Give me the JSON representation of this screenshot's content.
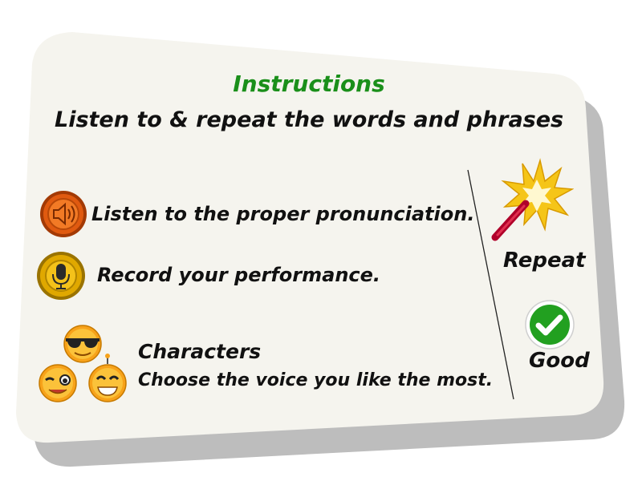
{
  "instructions": {
    "title": "Instructions",
    "subtitle": "Listen to & repeat the words and phrases",
    "listen_text": "Listen to the proper pronunciation.",
    "record_text": "Record your performance.",
    "characters_title": "Characters",
    "characters_text": "Choose the voice you like the most.",
    "repeat_label": "Repeat",
    "good_label": "Good"
  },
  "icons": {
    "listen": "speaker-icon",
    "record": "microphone-icon",
    "characters": [
      "sunglasses-face-icon",
      "winking-face-icon",
      "grinning-face-icon"
    ],
    "repeat": "firecracker-icon",
    "good": "checkmark-icon"
  },
  "colors": {
    "title": "#1a8f1a",
    "card": "#f5f4ee",
    "shadow": "#bdbdbd",
    "listen_button": "#e05a10",
    "record_button": "#e0a800",
    "good_check": "#22a020"
  }
}
